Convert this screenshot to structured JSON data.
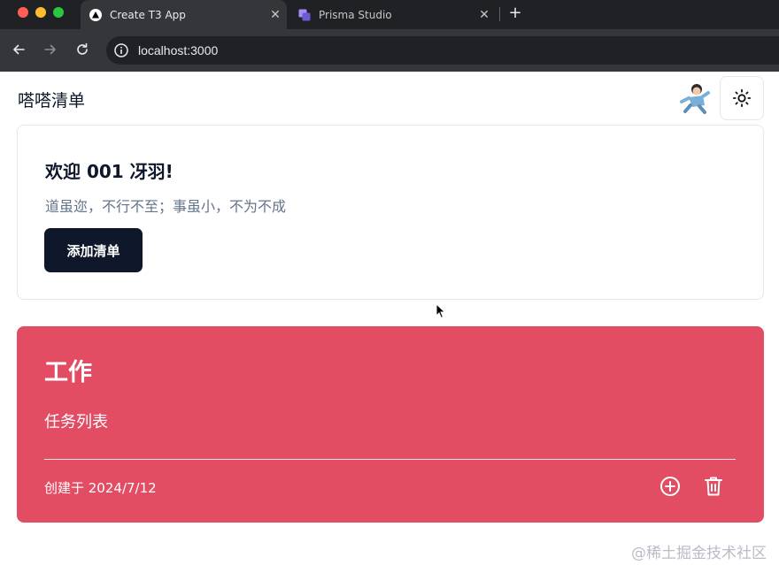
{
  "browser": {
    "tabs": [
      {
        "title": "Create T3 App",
        "icon": "triangle-logo-icon",
        "active": true
      },
      {
        "title": "Prisma Studio",
        "icon": "prisma-squares-icon",
        "active": false
      }
    ],
    "tab_close_glyph": "✕",
    "new_tab_glyph": "+",
    "url": "localhost:3000",
    "colors": {
      "tabbar": "#202124",
      "toolbar": "#35363a"
    }
  },
  "header": {
    "app_title": "嗒嗒清单",
    "avatar_icon": "avatar-icon",
    "theme_icon": "sun-icon"
  },
  "welcome": {
    "heading": "欢迎 001 冴羽!",
    "subtitle": "道虽迩，不行不至；事虽小，不为不成",
    "add_button_label": "添加清单"
  },
  "list_card": {
    "title": "工作",
    "description": "任务列表",
    "created_text": "创建于 2024/7/12",
    "add_icon": "plus-circle-icon",
    "delete_icon": "trash-icon",
    "color": "#e24d64"
  },
  "watermark": "@稀土掘金技术社区"
}
